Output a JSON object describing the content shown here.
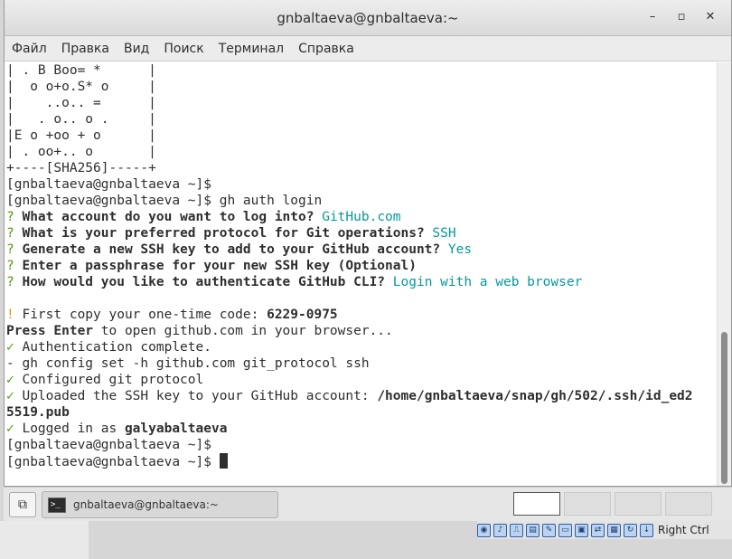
{
  "window": {
    "title": "gnbaltaeva@gnbaltaeva:~",
    "buttons": {
      "minimize": "–",
      "maximize": "▫",
      "close": "✕"
    }
  },
  "menu": [
    "Файл",
    "Правка",
    "Вид",
    "Поиск",
    "Терминал",
    "Справка"
  ],
  "terminal": {
    "randomart": [
      "| . B Boo= *      |",
      "|  o o+o.S* o     |",
      "|    ..o.. =      |",
      "|   . o.. o .     |",
      "|E o +oo + o      |",
      "| . oo+.. o       |",
      "+----[SHA256]-----+"
    ],
    "prompt": "[gnbaltaeva@gnbaltaeva ~]$",
    "command": " gh auth login",
    "qmark": "?",
    "questions": [
      {
        "q": "What account do you want to log into?",
        "a": "GitHub.com"
      },
      {
        "q": "What is your preferred protocol for Git operations?",
        "a": "SSH"
      },
      {
        "q": "Generate a new SSH key to add to your GitHub account?",
        "a": "Yes"
      },
      {
        "q": "Enter a passphrase for your new SSH key (Optional)",
        "a": ""
      },
      {
        "q": "How would you like to authenticate GitHub CLI?",
        "a": "Login with a web browser"
      }
    ],
    "code_mark": "!",
    "code_text": " First copy your one-time code: ",
    "code_value": "6229-0975",
    "press_bold": "Press Enter",
    "press_rest": " to open github.com in your browser...",
    "check": "✓",
    "dash": "-",
    "auth_complete": " Authentication complete.",
    "config_set": " gh config set -h github.com git_protocol ssh",
    "configured": " Configured git protocol",
    "uploaded": " Uploaded the SSH key to your GitHub account: ",
    "key_path_1": "/home/gnbaltaeva/snap/gh/502/.ssh/id_ed2",
    "key_path_2": "5519.pub",
    "logged_in": " Logged in as ",
    "username": "galyabaltaeva"
  },
  "taskbar": {
    "show_desktop_icon": "⧉",
    "task_icon_text": ">_",
    "task_label": "gnbaltaeva@gnbaltaeva:~"
  },
  "vbox": {
    "icons": [
      "cd-icon",
      "audio-icon",
      "usb-icon",
      "shared-folder-icon",
      "pencil-icon",
      "display-icon",
      "recording-icon",
      "network-icon",
      "cpu-icon",
      "mouse-integration-icon",
      "arrow-down-icon"
    ],
    "host_key": "Right Ctrl"
  }
}
